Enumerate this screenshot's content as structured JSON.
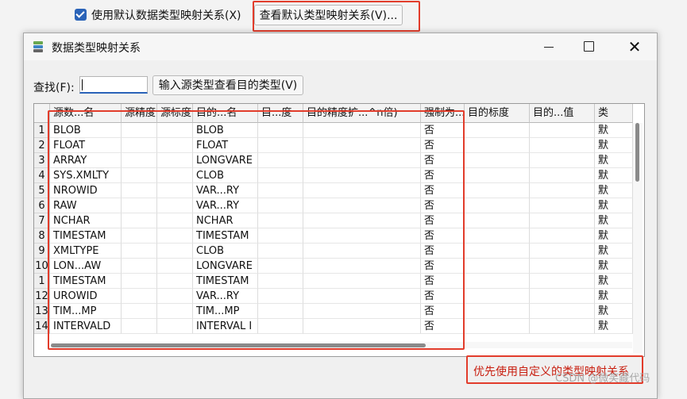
{
  "top": {
    "use_default_label": "使用默认数据类型映射关系(X)",
    "view_default_button": "查看默认类型映射关系(V)..."
  },
  "dialog": {
    "title": "数据类型映射关系",
    "find_label": "查找(F):",
    "find_value": "",
    "srctype_button": "输入源类型查看目的类型(V)"
  },
  "grid": {
    "columns": [
      "源数...名",
      "源精度",
      "源标度",
      "目的...名",
      "目...度",
      "目的精度扩...^n倍)",
      "强制为...",
      "目的标度",
      "目的...值",
      "类"
    ],
    "rows": [
      {
        "n": "1",
        "src": "BLOB",
        "dst": "BLOB",
        "force": "否",
        "type": "默"
      },
      {
        "n": "2",
        "src": "FLOAT",
        "dst": "FLOAT",
        "force": "否",
        "type": "默"
      },
      {
        "n": "3",
        "src": "ARRAY",
        "dst": "LONGVARE",
        "force": "否",
        "type": "默"
      },
      {
        "n": "4",
        "src": "SYS.XMLTY",
        "dst": "CLOB",
        "force": "否",
        "type": "默"
      },
      {
        "n": "5",
        "src": "NROWID",
        "dst": "VAR...RY",
        "force": "否",
        "type": "默"
      },
      {
        "n": "6",
        "src": "RAW",
        "dst": "VAR...RY",
        "force": "否",
        "type": "默"
      },
      {
        "n": "7",
        "src": "NCHAR",
        "dst": "NCHAR",
        "force": "否",
        "type": "默"
      },
      {
        "n": "8",
        "src": "TIMESTAM",
        "dst": "TIMESTAM",
        "force": "否",
        "type": "默"
      },
      {
        "n": "9",
        "src": "XMLTYPE",
        "dst": "CLOB",
        "force": "否",
        "type": "默"
      },
      {
        "n": "10",
        "src": "LON...AW",
        "dst": "LONGVARE",
        "force": "否",
        "type": "默"
      },
      {
        "n": "1",
        "src": "TIMESTAM",
        "dst": "TIMESTAM",
        "force": "否",
        "type": "默"
      },
      {
        "n": "12",
        "src": "UROWID",
        "dst": "VAR...RY",
        "force": "否",
        "type": "默"
      },
      {
        "n": "13",
        "src": "TIM...MP",
        "dst": "TIM...MP",
        "force": "否",
        "type": "默"
      },
      {
        "n": "14",
        "src": "INTERVALD",
        "dst": "INTERVAL I",
        "force": "否",
        "type": "默"
      }
    ]
  },
  "annotation": {
    "priority_note": "优先使用自定义的类型映射关系",
    "watermark": "CSDN @微笑藏代码"
  },
  "colors": {
    "accent": "#2a63b8",
    "annotation_red": "#e23c2b"
  }
}
